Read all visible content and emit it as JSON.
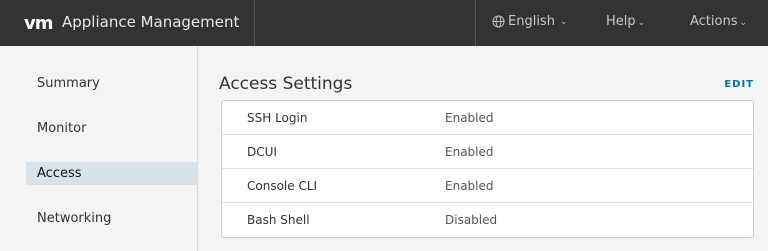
{
  "header": {
    "logo": "vm",
    "title": "Appliance Management",
    "language": "English",
    "help": "Help",
    "actions": "Actions"
  },
  "sidebar": {
    "items": [
      {
        "label": "Summary",
        "active": false
      },
      {
        "label": "Monitor",
        "active": false
      },
      {
        "label": "Access",
        "active": true
      },
      {
        "label": "Networking",
        "active": false
      }
    ]
  },
  "main": {
    "title": "Access Settings",
    "edit_label": "EDIT",
    "settings": [
      {
        "name": "SSH Login",
        "value": "Enabled"
      },
      {
        "name": "DCUI",
        "value": "Enabled"
      },
      {
        "name": "Console CLI",
        "value": "Enabled"
      },
      {
        "name": "Bash Shell",
        "value": "Disabled"
      }
    ]
  },
  "colors": {
    "header_bg": "#333333",
    "accent": "#0072a3",
    "active_nav_bg": "#d8e3e9"
  }
}
